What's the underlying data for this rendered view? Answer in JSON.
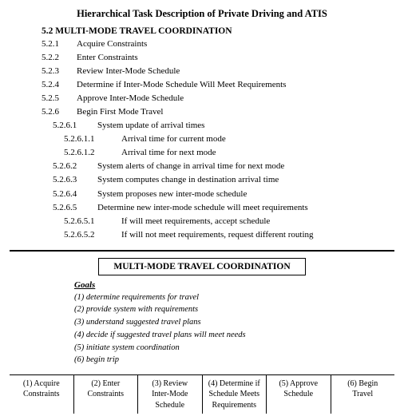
{
  "title": "Hierarchical Task Description of Private Driving and ATIS",
  "section": {
    "header": "5.2  MULTI-MODE TRAVEL COORDINATION",
    "items": [
      {
        "id": "5.2.1",
        "indent": 1,
        "text": "Acquire Constraints"
      },
      {
        "id": "5.2.2",
        "indent": 1,
        "text": "Enter Constraints"
      },
      {
        "id": "5.2.3",
        "indent": 1,
        "text": "Review Inter-Mode Schedule"
      },
      {
        "id": "5.2.4",
        "indent": 1,
        "text": "Determine if Inter-Mode Schedule Will Meet Requirements"
      },
      {
        "id": "5.2.5",
        "indent": 1,
        "text": "Approve Inter-Mode Schedule"
      },
      {
        "id": "5.2.6",
        "indent": 1,
        "text": "Begin First Mode Travel"
      },
      {
        "id": "5.2.6.1",
        "indent": 2,
        "text": "System update of arrival times"
      },
      {
        "id": "5.2.6.1.1",
        "indent": 3,
        "text": "Arrival time for current mode"
      },
      {
        "id": "5.2.6.1.2",
        "indent": 3,
        "text": "Arrival time for next mode"
      },
      {
        "id": "5.2.6.2",
        "indent": 2,
        "text": "System alerts of change in arrival time for next mode"
      },
      {
        "id": "5.2.6.3",
        "indent": 2,
        "text": "System computes change in destination arrival time"
      },
      {
        "id": "5.2.6.4",
        "indent": 2,
        "text": "System proposes new inter-mode schedule"
      },
      {
        "id": "5.2.6.5",
        "indent": 2,
        "text": "Determine new inter-mode schedule will meet requirements"
      },
      {
        "id": "5.2.6.5.1",
        "indent": 3,
        "text": "If will meet requirements, accept schedule"
      },
      {
        "id": "5.2.6.5.2",
        "indent": 3,
        "text": "If will not meet requirements, request different routing"
      }
    ]
  },
  "lower_box_label": "MULTI-MODE TRAVEL COORDINATION",
  "goals": {
    "title": "Goals",
    "items": [
      "(1) determine requirements for travel",
      "(2) provide system with requirements",
      "(3) understand suggested travel plans",
      "(4) decide if suggested travel plans will meet needs",
      "(5) initiate system coordination",
      "(6) begin trip"
    ]
  },
  "steps": [
    {
      "num": "(1)",
      "label": "Acquire\nConstraints"
    },
    {
      "num": "(2)",
      "label": "Enter\nConstraints"
    },
    {
      "num": "(3)",
      "label": "Review\nInter-Mode\nSchedule"
    },
    {
      "num": "(4)",
      "label": "Determine if\nSchedule Meets\nRequirements"
    },
    {
      "num": "(5)",
      "label": "Approve\nSchedule"
    },
    {
      "num": "(6)",
      "label": "Begin\nTravel"
    }
  ]
}
